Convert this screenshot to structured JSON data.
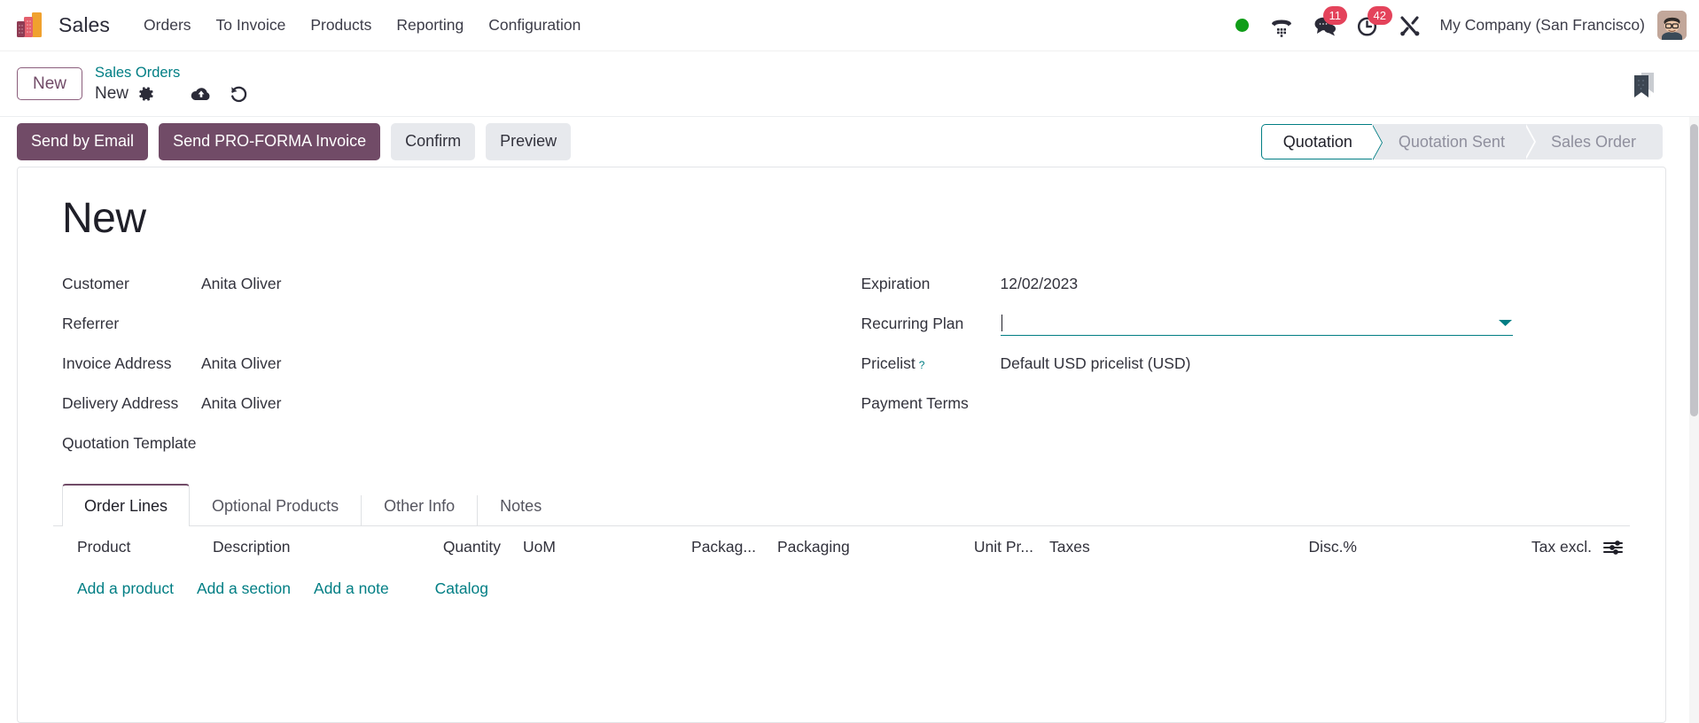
{
  "navbar": {
    "brand": "Sales",
    "logo_icon": "odoo-logo-icon",
    "menu_items": [
      {
        "label": "Orders",
        "name": "menu-orders"
      },
      {
        "label": "To Invoice",
        "name": "menu-to-invoice"
      },
      {
        "label": "Products",
        "name": "menu-products"
      },
      {
        "label": "Reporting",
        "name": "menu-reporting"
      },
      {
        "label": "Configuration",
        "name": "menu-configuration"
      }
    ],
    "status_dot_color": "#0f9d18",
    "icons": {
      "presence": "presence-dot-icon",
      "dialpad": "phone-dialpad-icon",
      "messages": "chat-bubble-icon",
      "activities": "clock-activity-icon",
      "tools": "tools-wrench-icon"
    },
    "messages_count": "11",
    "activities_count": "42",
    "badge_color": "#e4435b",
    "company": "My Company (San Francisco)",
    "avatar_name": "user-avatar"
  },
  "breadcrumb": {
    "new_button": "New",
    "parent": "Sales Orders",
    "current": "New",
    "gear_icon": "gear-icon",
    "save_icon": "cloud-save-icon",
    "discard_icon": "undo-discard-icon",
    "bookmark_icon": "bookmark-ribbon-icon"
  },
  "control_panel": {
    "buttons": [
      {
        "label": "Send by Email",
        "style": "primary",
        "name": "send-by-email-button"
      },
      {
        "label": "Send PRO-FORMA Invoice",
        "style": "primary",
        "name": "send-pro-forma-invoice-button"
      },
      {
        "label": "Confirm",
        "style": "secondary",
        "name": "confirm-button"
      },
      {
        "label": "Preview",
        "style": "secondary",
        "name": "preview-button"
      }
    ],
    "statusbar": [
      {
        "label": "Quotation",
        "active": true,
        "name": "status-quotation"
      },
      {
        "label": "Quotation Sent",
        "active": false,
        "name": "status-quotation-sent"
      },
      {
        "label": "Sales Order",
        "active": false,
        "name": "status-sales-order"
      }
    ],
    "accent_color": "#714b67",
    "active_status_color": "#017e84"
  },
  "form": {
    "title": "New",
    "left_fields": [
      {
        "label": "Customer",
        "value": "Anita Oliver",
        "name": "field-customer"
      },
      {
        "label": "Referrer",
        "value": "",
        "name": "field-referrer"
      },
      {
        "label": "Invoice Address",
        "value": "Anita Oliver",
        "name": "field-invoice-address"
      },
      {
        "label": "Delivery Address",
        "value": "Anita Oliver",
        "name": "field-delivery-address"
      },
      {
        "label": "Quotation Template",
        "value": "",
        "name": "field-quotation-template"
      }
    ],
    "right_fields": [
      {
        "label": "Expiration",
        "value": "12/02/2023",
        "name": "field-expiration",
        "focused": false,
        "tooltip": ""
      },
      {
        "label": "Recurring Plan",
        "value": "",
        "name": "field-recurring-plan",
        "focused": true,
        "tooltip": ""
      },
      {
        "label": "Pricelist",
        "value": "Default USD pricelist (USD)",
        "name": "field-pricelist",
        "focused": false,
        "tooltip": "?"
      },
      {
        "label": "Payment Terms",
        "value": "",
        "name": "field-payment-terms",
        "focused": false,
        "tooltip": ""
      }
    ]
  },
  "notebook": {
    "tabs": [
      {
        "label": "Order Lines",
        "active": true,
        "name": "tab-order-lines"
      },
      {
        "label": "Optional Products",
        "active": false,
        "name": "tab-optional-products"
      },
      {
        "label": "Other Info",
        "active": false,
        "name": "tab-other-info"
      },
      {
        "label": "Notes",
        "active": false,
        "name": "tab-notes"
      }
    ],
    "columns": {
      "product": "Product",
      "description": "Description",
      "quantity": "Quantity",
      "uom": "UoM",
      "packaging_qty": "Packag...",
      "packaging": "Packaging",
      "unit_price": "Unit Pr...",
      "taxes": "Taxes",
      "discount": "Disc.%",
      "tax_excl": "Tax excl."
    },
    "optional_columns_icon": "column-settings-sliders-icon",
    "rows": [],
    "add_links": [
      {
        "label": "Add a product",
        "name": "add-a-product-link",
        "spaced": false
      },
      {
        "label": "Add a section",
        "name": "add-a-section-link",
        "spaced": false
      },
      {
        "label": "Add a note",
        "name": "add-a-note-link",
        "spaced": false
      },
      {
        "label": "Catalog",
        "name": "catalog-link",
        "spaced": true
      }
    ]
  }
}
